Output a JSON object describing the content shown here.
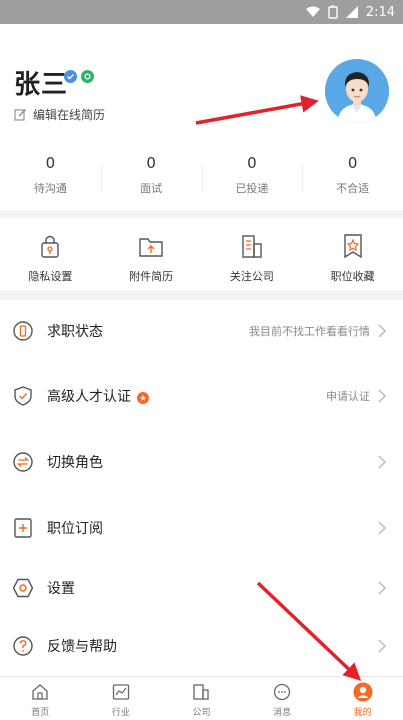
{
  "status_bar": {
    "time": "2:14"
  },
  "profile": {
    "name": "张三",
    "edit_resume": "编辑在线简历",
    "avatar_icon": "user-avatar"
  },
  "stats": [
    {
      "count": "0",
      "label": "待沟通"
    },
    {
      "count": "0",
      "label": "面试"
    },
    {
      "count": "0",
      "label": "已投递"
    },
    {
      "count": "0",
      "label": "不合适"
    }
  ],
  "shortcuts": [
    {
      "label": "隐私设置",
      "icon": "lock-icon"
    },
    {
      "label": "附件简历",
      "icon": "folder-upload-icon"
    },
    {
      "label": "关注公司",
      "icon": "building-icon"
    },
    {
      "label": "职位收藏",
      "icon": "star-bookmark-icon"
    }
  ],
  "menu": [
    {
      "title": "求职状态",
      "value": "我目前不找工作看看行情",
      "icon": "status-icon"
    },
    {
      "title": "高级人才认证",
      "value": "申请认证",
      "icon": "shield-icon"
    },
    {
      "title": "切换角色",
      "value": "",
      "icon": "switch-icon"
    },
    {
      "title": "职位订阅",
      "value": "",
      "icon": "subscribe-icon"
    },
    {
      "title": "设置",
      "value": "",
      "icon": "gear-icon"
    },
    {
      "title": "反馈与帮助",
      "value": "",
      "icon": "help-icon"
    }
  ],
  "tabs": [
    {
      "label": "首页",
      "icon": "home-icon"
    },
    {
      "label": "行业",
      "icon": "chart-icon"
    },
    {
      "label": "公司",
      "icon": "company-icon"
    },
    {
      "label": "消息",
      "icon": "message-icon"
    },
    {
      "label": "我的",
      "icon": "profile-icon"
    }
  ],
  "colors": {
    "accent": "#f26a21",
    "annotation_arrow": "#e5202a",
    "status_bar": "#9e9e9e"
  }
}
